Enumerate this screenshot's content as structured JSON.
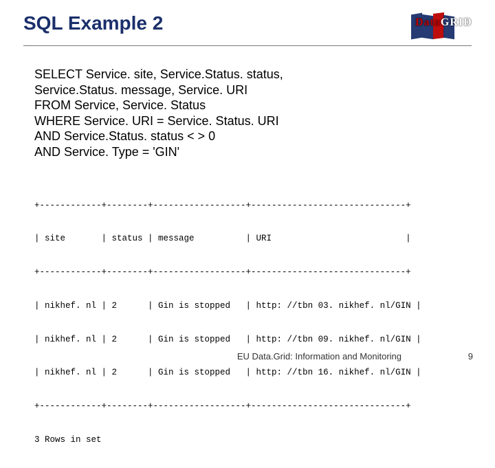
{
  "title": "SQL Example 2",
  "logo_text_data": "Data",
  "logo_text_grid": "GRID",
  "sql": {
    "l1": "SELECT Service. site, Service.Status. status,",
    "l2": "Service.Status. message, Service. URI",
    "l3": "FROM Service, Service. Status",
    "l4": "WHERE Service. URI = Service. Status. URI",
    "l5": "AND Service.Status. status < > 0",
    "l6": "AND Service. Type = 'GIN'"
  },
  "table": {
    "border_top": "+------------+--------+------------------+------------------------------+",
    "header_row": "| site       | status | message          | URI                          |",
    "border_mid": "+------------+--------+------------------+------------------------------+",
    "row1": "| nikhef. nl | 2      | Gin is stopped   | http: //tbn 03. nikhef. nl/GIN |",
    "row2": "| nikhef. nl | 2      | Gin is stopped   | http: //tbn 09. nikhef. nl/GIN |",
    "row3": "| nikhef. nl | 2      | Gin is stopped   | http: //tbn 16. nikhef. nl/GIN |",
    "border_bot": "+------------+--------+------------------+------------------------------+",
    "footer": "3 Rows in set"
  },
  "footer_text": "EU Data.Grid: Information and Monitoring",
  "page_number": "9"
}
